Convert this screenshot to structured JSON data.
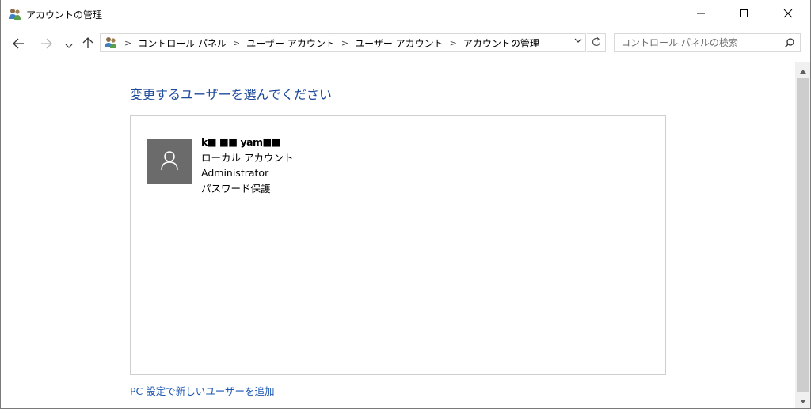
{
  "window": {
    "title": "アカウントの管理",
    "icon": "users-control-panel-icon",
    "buttons": {
      "minimize": "minimize-icon",
      "maximize": "maximize-icon",
      "close": "close-icon"
    }
  },
  "nav": {
    "back_icon": "arrow-left-icon",
    "forward_icon": "arrow-right-icon",
    "recent_icon": "chevron-down-icon",
    "up_icon": "arrow-up-icon",
    "breadcrumbs": [
      "コントロール パネル",
      "ユーザー アカウント",
      "ユーザー アカウント",
      "アカウントの管理"
    ],
    "search_placeholder": "コントロール パネルの検索"
  },
  "main": {
    "heading": "変更するユーザーを選んでください",
    "users": [
      {
        "name": "k■ ■■ yam■■",
        "account_type": "ローカル アカウント",
        "role": "Administrator",
        "protection": "パスワード保護"
      }
    ],
    "add_user_link": "PC 設定で新しいユーザーを追加"
  },
  "colors": {
    "heading": "#1e4a9b",
    "link": "#1a56b0",
    "avatar_bg": "#6b6b6b",
    "scrollbar_thumb": "#cdcdcd"
  }
}
